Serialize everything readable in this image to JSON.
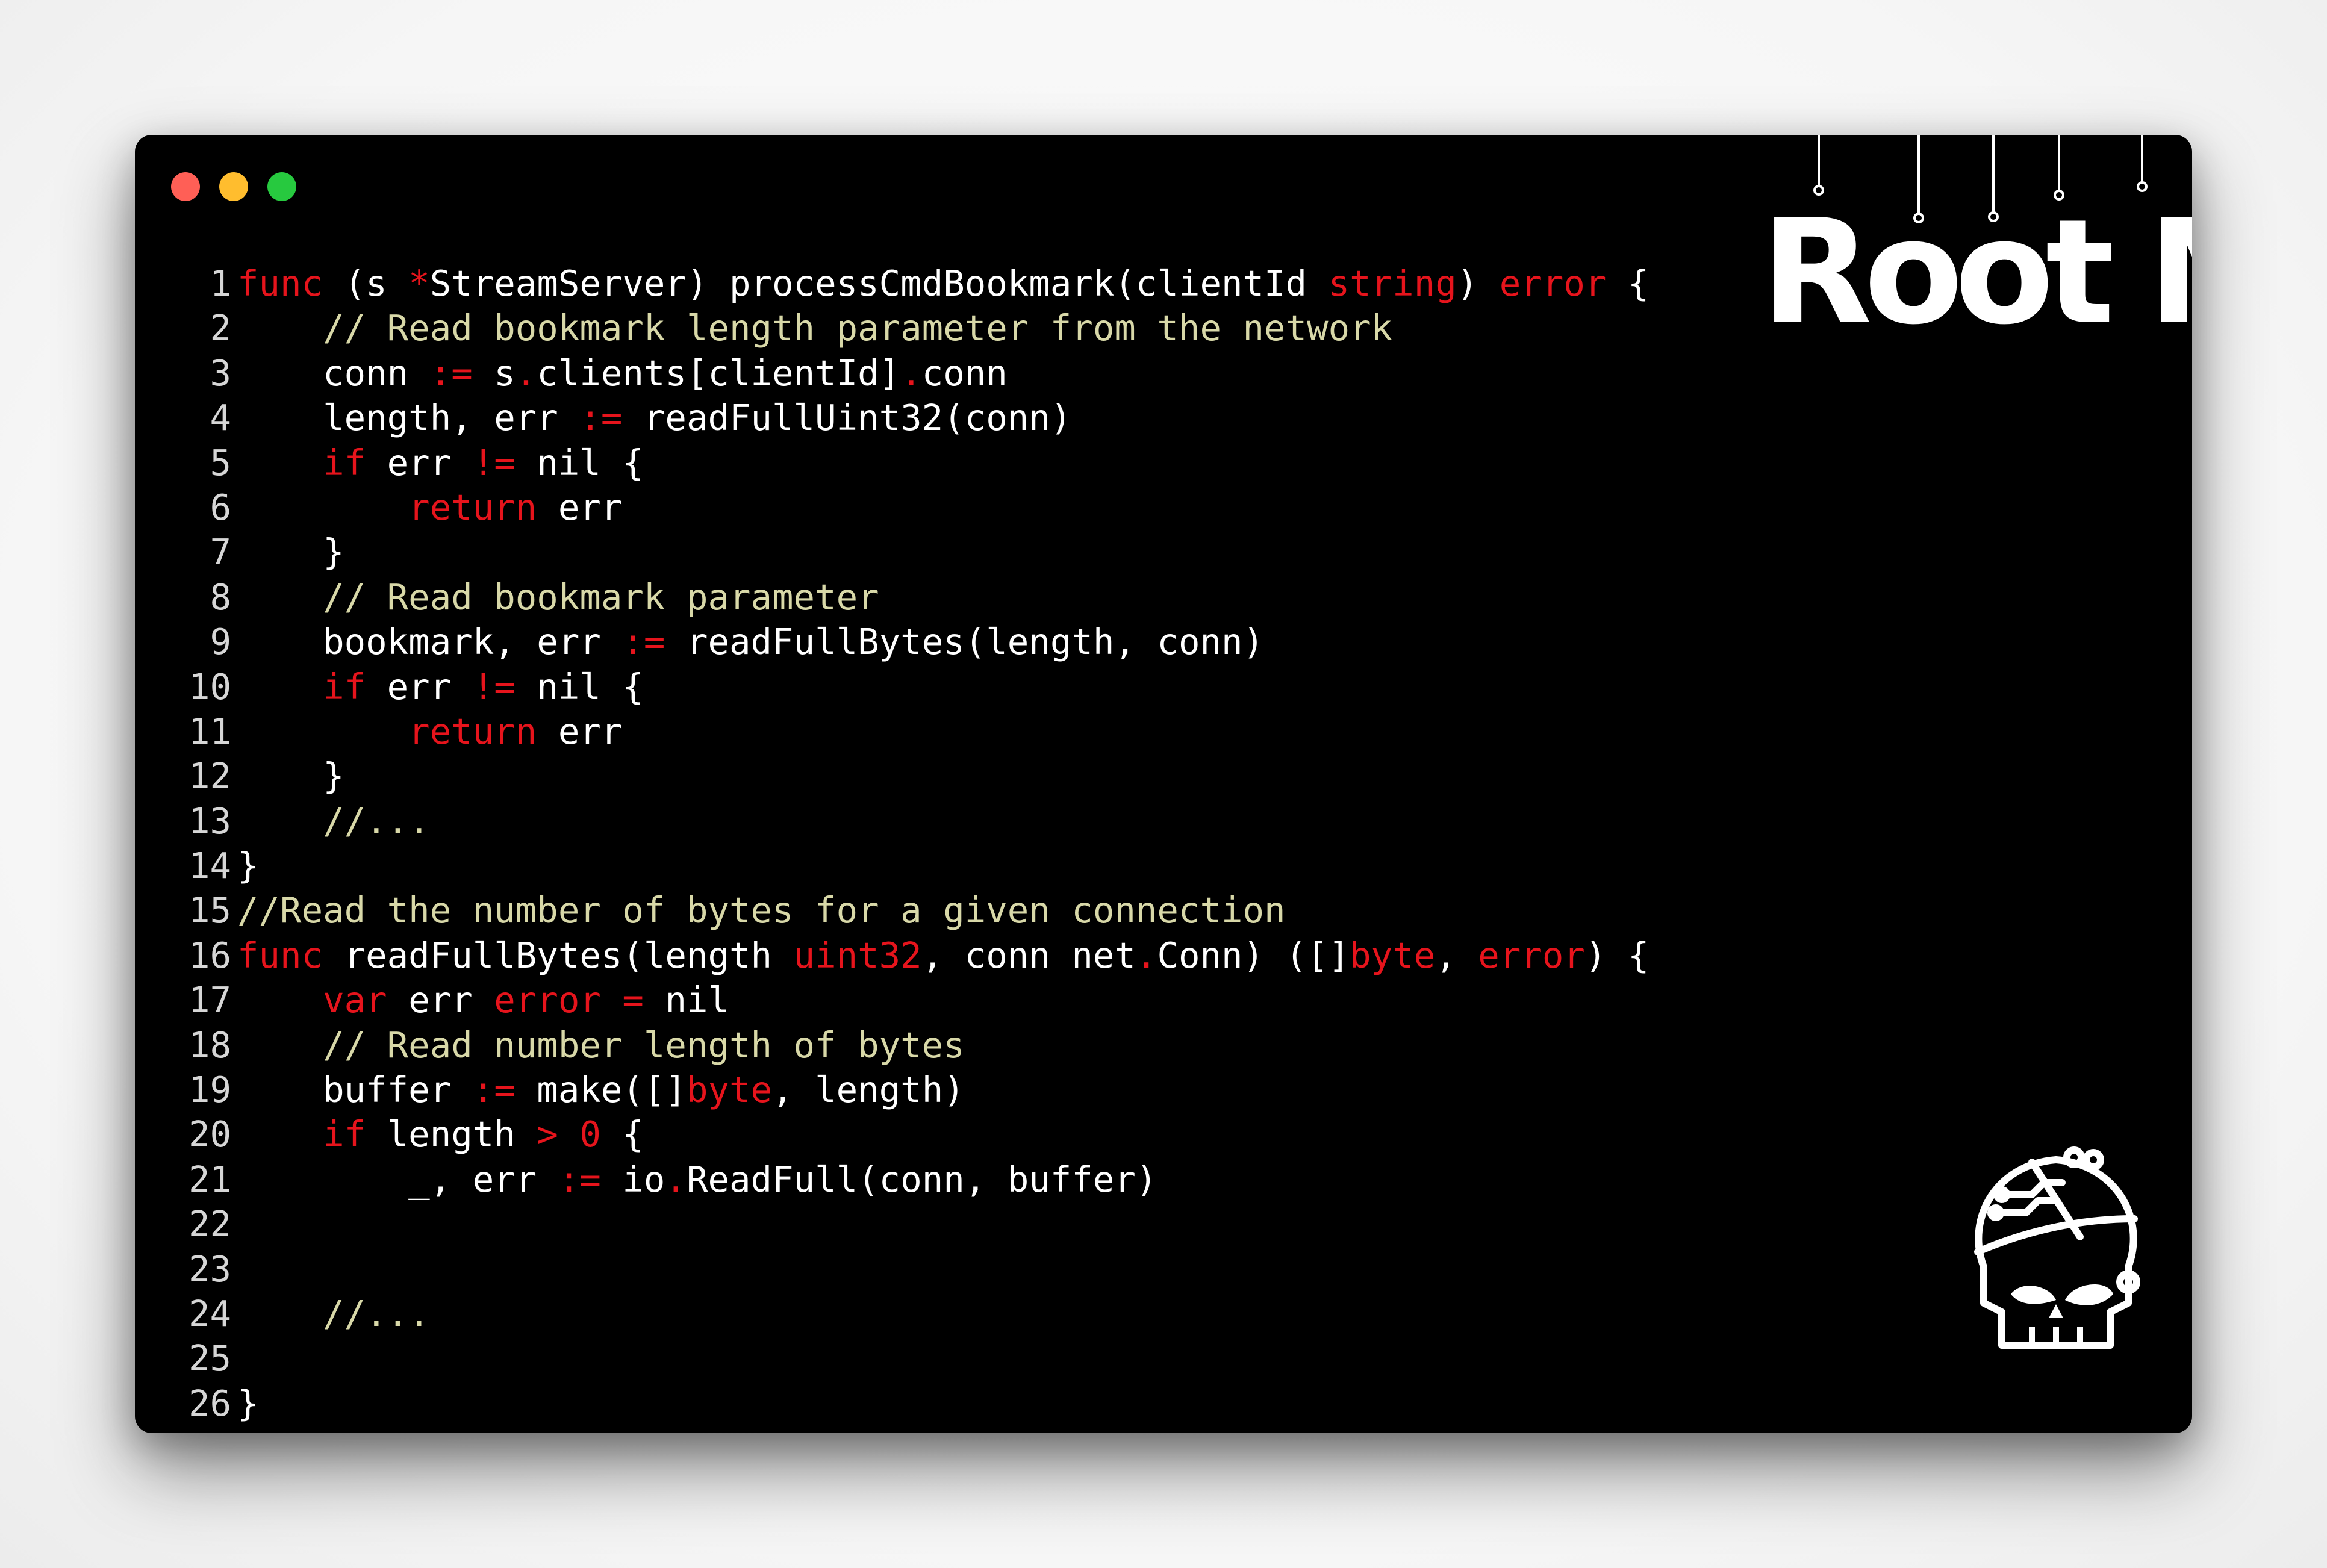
{
  "window": {
    "controls": {
      "close_color": "#ff5f56",
      "minimize_color": "#ffbd2e",
      "maximize_color": "#27c93f"
    }
  },
  "brand": {
    "logo_text": "Root Me",
    "mascot_icon": "skull-brain-circuit-icon"
  },
  "theme": {
    "background": "#000000",
    "keyword_color": "#e6141c",
    "comment_color": "#d8d8a8",
    "text_color": "#ffffff"
  },
  "code": {
    "language": "go",
    "lines": [
      {
        "n": "1",
        "tokens": [
          [
            "kw",
            "func"
          ],
          [
            "tx",
            " (s "
          ],
          [
            "kw",
            "*"
          ],
          [
            "tx",
            "StreamServer) processCmdBookmark(clientId "
          ],
          [
            "kw",
            "string"
          ],
          [
            "tx",
            ") "
          ],
          [
            "kw",
            "error"
          ],
          [
            "tx",
            " {"
          ]
        ]
      },
      {
        "n": "2",
        "tokens": [
          [
            "tx",
            "    "
          ],
          [
            "cm",
            "// Read bookmark length parameter from the network"
          ]
        ]
      },
      {
        "n": "3",
        "tokens": [
          [
            "tx",
            "    conn "
          ],
          [
            "kw",
            ":="
          ],
          [
            "tx",
            " s"
          ],
          [
            "kw",
            "."
          ],
          [
            "tx",
            "clients[clientId]"
          ],
          [
            "kw",
            "."
          ],
          [
            "tx",
            "conn"
          ]
        ]
      },
      {
        "n": "4",
        "tokens": [
          [
            "tx",
            "    length, err "
          ],
          [
            "kw",
            ":="
          ],
          [
            "tx",
            " readFullUint32(conn)"
          ]
        ]
      },
      {
        "n": "5",
        "tokens": [
          [
            "tx",
            "    "
          ],
          [
            "kw",
            "if"
          ],
          [
            "tx",
            " err "
          ],
          [
            "kw",
            "!="
          ],
          [
            "tx",
            " nil {"
          ]
        ]
      },
      {
        "n": "6",
        "tokens": [
          [
            "tx",
            "        "
          ],
          [
            "kw",
            "return"
          ],
          [
            "tx",
            " err"
          ]
        ]
      },
      {
        "n": "7",
        "tokens": [
          [
            "tx",
            "    }"
          ]
        ]
      },
      {
        "n": "8",
        "tokens": [
          [
            "tx",
            "    "
          ],
          [
            "cm",
            "// Read bookmark parameter"
          ]
        ]
      },
      {
        "n": "9",
        "tokens": [
          [
            "tx",
            "    bookmark, err "
          ],
          [
            "kw",
            ":="
          ],
          [
            "tx",
            " readFullBytes(length, conn)"
          ]
        ]
      },
      {
        "n": "10",
        "tokens": [
          [
            "tx",
            "    "
          ],
          [
            "kw",
            "if"
          ],
          [
            "tx",
            " err "
          ],
          [
            "kw",
            "!="
          ],
          [
            "tx",
            " nil {"
          ]
        ]
      },
      {
        "n": "11",
        "tokens": [
          [
            "tx",
            "        "
          ],
          [
            "kw",
            "return"
          ],
          [
            "tx",
            " err"
          ]
        ]
      },
      {
        "n": "12",
        "tokens": [
          [
            "tx",
            "    }"
          ]
        ]
      },
      {
        "n": "13",
        "tokens": [
          [
            "tx",
            "    "
          ],
          [
            "cm",
            "//..."
          ]
        ]
      },
      {
        "n": "14",
        "tokens": [
          [
            "tx",
            "}"
          ]
        ]
      },
      {
        "n": "15",
        "tokens": [
          [
            "cm",
            "//Read the number of bytes for a given connection"
          ]
        ]
      },
      {
        "n": "16",
        "tokens": [
          [
            "kw",
            "func"
          ],
          [
            "tx",
            " readFullBytes(length "
          ],
          [
            "kw",
            "uint32"
          ],
          [
            "tx",
            ", conn net"
          ],
          [
            "kw",
            "."
          ],
          [
            "tx",
            "Conn) ([]"
          ],
          [
            "kw",
            "byte"
          ],
          [
            "tx",
            ", "
          ],
          [
            "kw",
            "error"
          ],
          [
            "tx",
            ") {"
          ]
        ]
      },
      {
        "n": "17",
        "tokens": [
          [
            "tx",
            "    "
          ],
          [
            "kw",
            "var"
          ],
          [
            "tx",
            " err "
          ],
          [
            "kw",
            "error"
          ],
          [
            "tx",
            " "
          ],
          [
            "kw",
            "="
          ],
          [
            "tx",
            " nil"
          ]
        ]
      },
      {
        "n": "18",
        "tokens": [
          [
            "tx",
            "    "
          ],
          [
            "cm",
            "// Read number length of bytes"
          ]
        ]
      },
      {
        "n": "19",
        "tokens": [
          [
            "tx",
            "    buffer "
          ],
          [
            "kw",
            ":="
          ],
          [
            "tx",
            " make([]"
          ],
          [
            "kw",
            "byte"
          ],
          [
            "tx",
            ", length)"
          ]
        ]
      },
      {
        "n": "20",
        "tokens": [
          [
            "tx",
            "    "
          ],
          [
            "kw",
            "if"
          ],
          [
            "tx",
            " length "
          ],
          [
            "kw",
            ">"
          ],
          [
            "tx",
            " "
          ],
          [
            "kw",
            "0"
          ],
          [
            "tx",
            " {"
          ]
        ]
      },
      {
        "n": "21",
        "tokens": [
          [
            "tx",
            "        _, err "
          ],
          [
            "kw",
            ":="
          ],
          [
            "tx",
            " io"
          ],
          [
            "kw",
            "."
          ],
          [
            "tx",
            "ReadFull(conn, buffer)"
          ]
        ]
      },
      {
        "n": "22",
        "tokens": []
      },
      {
        "n": "23",
        "tokens": []
      },
      {
        "n": "24",
        "tokens": [
          [
            "tx",
            "    "
          ],
          [
            "cm",
            "//..."
          ]
        ]
      },
      {
        "n": "25",
        "tokens": []
      },
      {
        "n": "26",
        "tokens": [
          [
            "tx",
            "}"
          ]
        ]
      }
    ]
  }
}
